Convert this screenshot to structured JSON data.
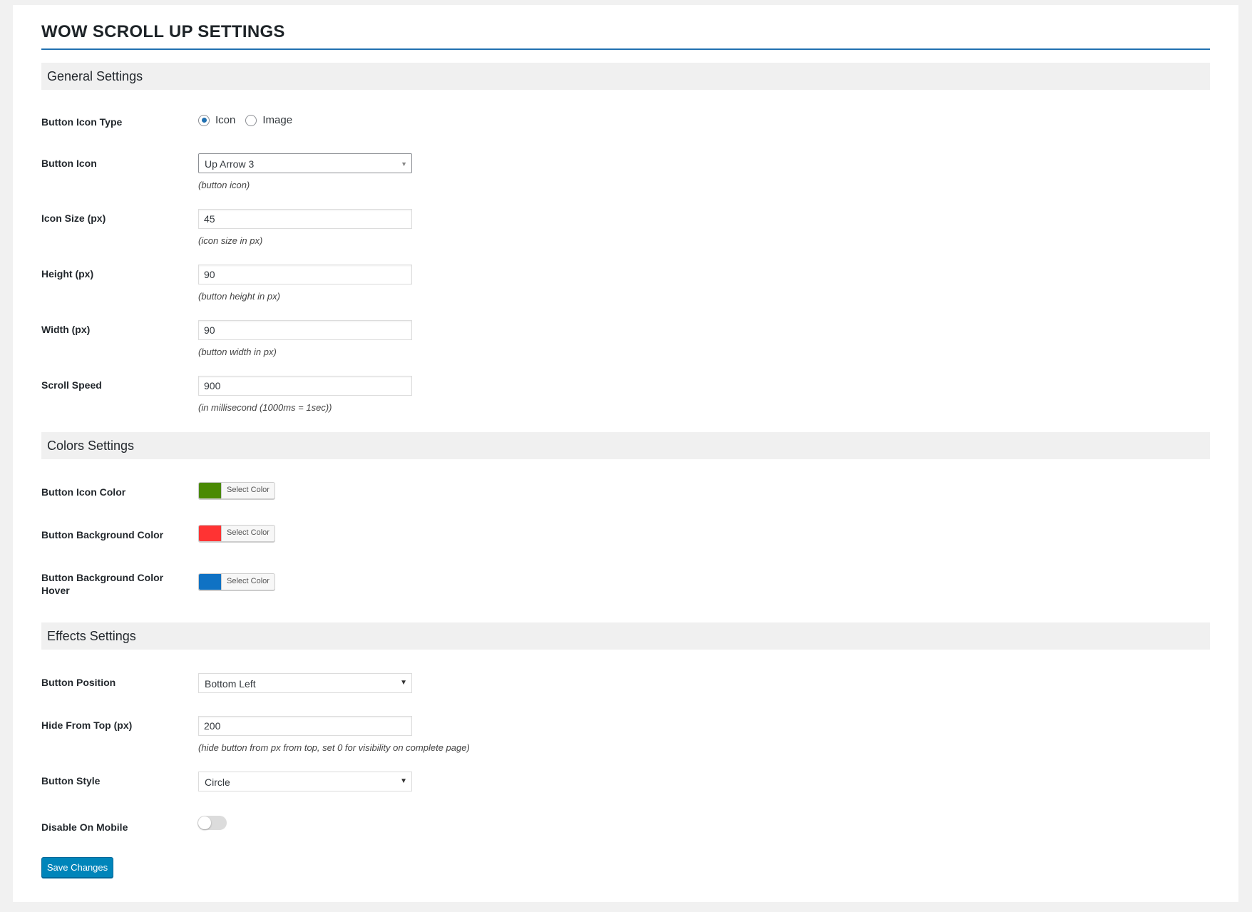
{
  "page": {
    "title": "WOW SCROLL UP SETTINGS"
  },
  "general": {
    "heading": "General Settings",
    "icon_type": {
      "label": "Button Icon Type",
      "options": [
        "Icon",
        "Image"
      ],
      "selected": "Icon"
    },
    "button_icon": {
      "label": "Button Icon",
      "value": "Up Arrow 3",
      "hint": "(button icon)"
    },
    "icon_size": {
      "label": "Icon Size (px)",
      "value": "45",
      "hint": "(icon size in px)"
    },
    "height": {
      "label": "Height (px)",
      "value": "90",
      "hint": "(button height in px)"
    },
    "width": {
      "label": "Width (px)",
      "value": "90",
      "hint": "(button width in px)"
    },
    "scroll_speed": {
      "label": "Scroll Speed",
      "value": "900",
      "hint": "(in millisecond (1000ms = 1sec))"
    }
  },
  "colors": {
    "heading": "Colors Settings",
    "icon_color": {
      "label": "Button Icon Color",
      "button": "Select Color",
      "color": "#4a8a03"
    },
    "bg_color": {
      "label": "Button Background Color",
      "button": "Select Color",
      "color": "#ff3333"
    },
    "bg_hover": {
      "label_line1": "Button Background Color",
      "label_line2": "Hover",
      "button": "Select Color",
      "color": "#0f72c4"
    }
  },
  "effects": {
    "heading": "Effects Settings",
    "position": {
      "label": "Button Position",
      "value": "Bottom Left"
    },
    "hide_from_top": {
      "label": "Hide From Top (px)",
      "value": "200",
      "hint": "(hide button from px from top, set 0 for visibility on complete page)"
    },
    "style": {
      "label": "Button Style",
      "value": "Circle"
    },
    "disable_mobile": {
      "label": "Disable On Mobile",
      "enabled": false
    }
  },
  "actions": {
    "save_label": "Save Changes"
  },
  "theme": {
    "accent": "#0085ba",
    "rule": "#2271b1"
  }
}
